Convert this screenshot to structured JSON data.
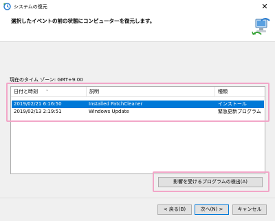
{
  "window": {
    "title": "システムの復元",
    "close_glyph": "✕"
  },
  "header": {
    "instruction": "選択したイベントの前の状態にコンピューターを復元します。"
  },
  "timezone": {
    "label": "現在のタイム ゾーン: GMT+9:00"
  },
  "restore_points": {
    "columns": [
      "日付と時刻",
      "説明",
      "種類"
    ],
    "rows": [
      {
        "date": "2019/02/21 6:16:50",
        "description": "Installed PatchCleaner",
        "type": "インストール",
        "selected": true
      },
      {
        "date": "2019/02/13 2:19:51",
        "description": "Windows Update",
        "type": "緊急更新プログラム",
        "selected": false
      }
    ]
  },
  "buttons": {
    "scan": "影響を受けるプログラムの検出(A)",
    "back": "< 戻る(B)",
    "next": "次へ(N) >",
    "cancel": "キャンセル"
  },
  "colors": {
    "selection": "#0078d7",
    "highlight": "#f2a6c8",
    "content_bg": "#f0f0f0"
  }
}
